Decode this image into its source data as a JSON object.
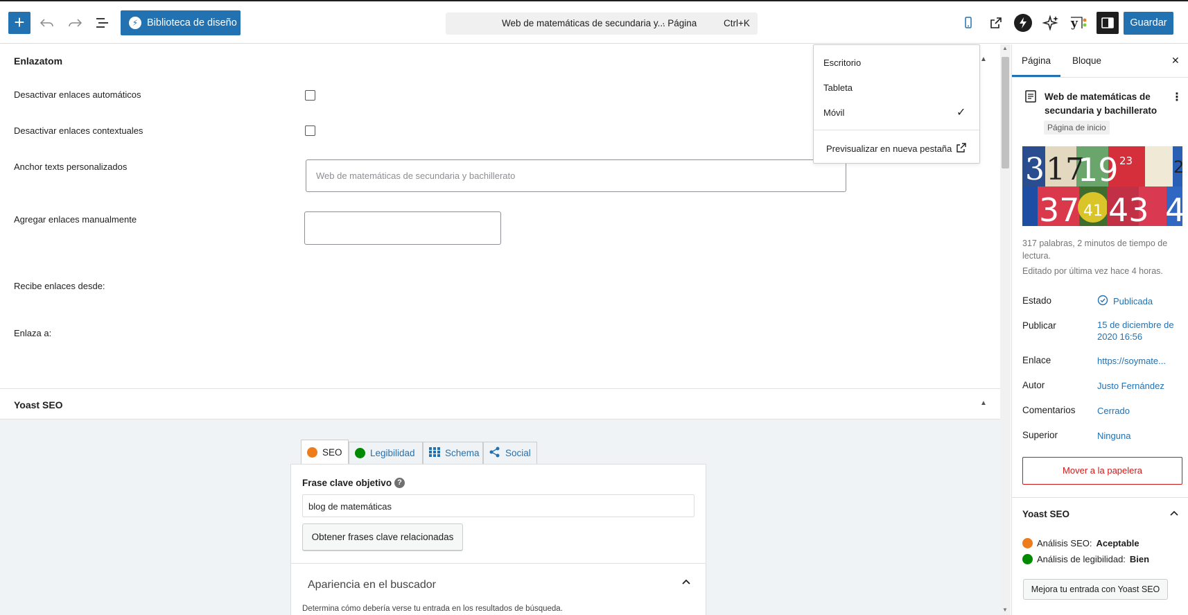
{
  "toolbar": {
    "add_label": "+",
    "library_label": "Biblioteca de diseño",
    "command_title": "Web de matemáticas de secundaria y...",
    "command_kind": "· Página",
    "command_shortcut": "Ctrl+K",
    "save_label": "Guardar"
  },
  "enlazatom": {
    "title": "Enlazatom",
    "disable_auto": "Desactivar enlaces automáticos",
    "disable_contextual": "Desactivar enlaces contextuales",
    "anchor_label": "Anchor texts personalizados",
    "anchor_placeholder": "Web de matemáticas de secundaria y bachillerato",
    "manual_label": "Agregar enlaces manualmente",
    "receives_label": "Recibe enlaces desde:",
    "links_to_label": "Enlaza a:"
  },
  "yoast_panel": {
    "title": "Yoast SEO",
    "tabs": [
      {
        "label": "SEO",
        "smile_color": "#ee7c1b"
      },
      {
        "label": "Legibilidad",
        "smile_color": "#008a00"
      },
      {
        "label": "Schema"
      },
      {
        "label": "Social"
      }
    ],
    "keyphrase_label": "Frase clave objetivo",
    "help_icon": "?",
    "keyphrase_value": "blog de matemáticas",
    "related_button": "Obtener frases clave relacionadas",
    "appearance_title": "Apariencia en el buscador",
    "appearance_desc": "Determina cómo debería verse tu entrada en los resultados de búsqueda."
  },
  "device_menu": {
    "items": [
      "Escritorio",
      "Tableta",
      "Móvil"
    ],
    "selected": "Móvil",
    "check": "✓",
    "preview_label": "Previsualizar en nueva pestaña"
  },
  "sidebar": {
    "tab_page": "Página",
    "tab_block": "Bloque",
    "close": "✕",
    "page_title": "Web de matemáticas de secundaria y bachillerato",
    "page_badge": "Página de inicio",
    "menu_dots": "⋮",
    "stats": "317 palabras, 2 minutos de tiempo de lectura.",
    "edited": "Editado por última vez hace 4 horas.",
    "rows": [
      {
        "label": "Estado",
        "value": "Publicada"
      },
      {
        "label": "Publicar",
        "value": "15 de diciembre de 2020 16:56"
      },
      {
        "label": "Enlace",
        "value": "https://soymate..."
      },
      {
        "label": "Autor",
        "value": "Justo Fernández"
      },
      {
        "label": "Comentarios",
        "value": "Cerrado"
      },
      {
        "label": "Superior",
        "value": "Ninguna"
      }
    ],
    "trash_label": "Mover a la papelera",
    "yoast_title": "Yoast SEO",
    "seo_analysis_label": "Análisis SEO:",
    "seo_analysis_value": "Aceptable",
    "readability_label": "Análisis de legibilidad:",
    "readability_value": "Bien",
    "improve_button": "Mejora tu entrada con Yoast SEO",
    "colors": {
      "seo_smile": "#ee7c1b",
      "read_smile": "#008a00",
      "trash": "#cc1818"
    }
  },
  "image_numbers": [
    "3",
    "17",
    "19",
    "23",
    "2",
    "37",
    "41",
    "43",
    "4"
  ]
}
